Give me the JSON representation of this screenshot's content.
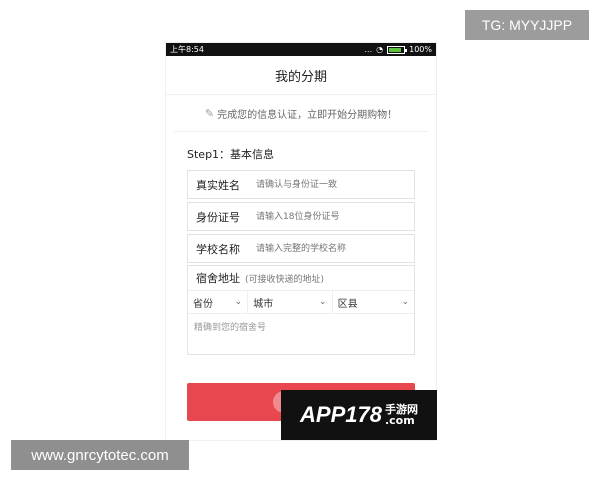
{
  "watermarks": {
    "top": "TG: MYYJJPP",
    "bottom": "www.gnrcytotec.com"
  },
  "status_bar": {
    "time": "上午8:54",
    "signal": "...",
    "battery": "100%"
  },
  "header": {
    "title": "我的分期"
  },
  "notice": {
    "icon": "edit-icon",
    "text": "完成您的信息认证，立即开始分期购物！"
  },
  "form": {
    "step_title": "Step1：基本信息",
    "fields": [
      {
        "label": "真实姓名",
        "placeholder": "请确认与身份证一致"
      },
      {
        "label": "身份证号",
        "placeholder": "请输入18位身份证号"
      },
      {
        "label": "学校名称",
        "placeholder": "请输入完整的学校名称"
      }
    ],
    "address": {
      "label": "宿舍地址",
      "hint": "(可接收快递的地址)",
      "selects": [
        "省份",
        "城市",
        "区县"
      ],
      "detail_placeholder": "精确到您的宿舍号"
    }
  },
  "brand": {
    "text": "APP178",
    "sub_top": "手游网",
    "sub_bottom": ".com"
  }
}
